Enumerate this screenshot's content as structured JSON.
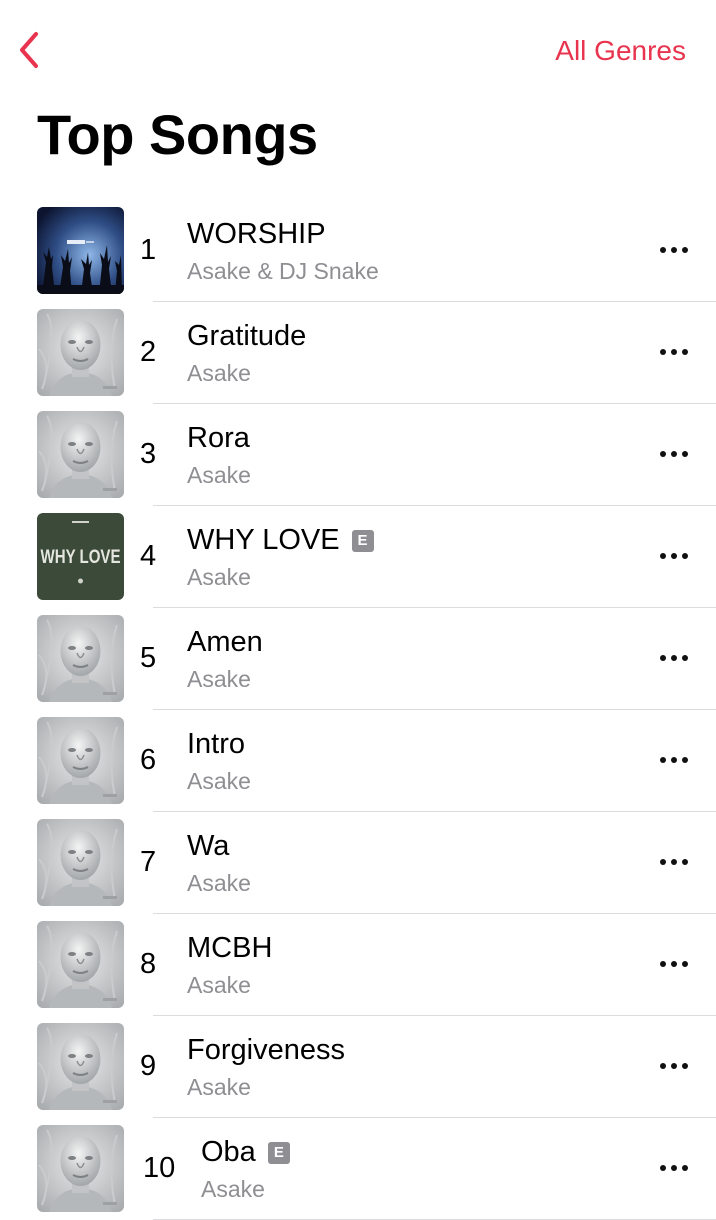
{
  "theme": {
    "accent": "#e8344e",
    "secondary_text": "#8e8e93"
  },
  "nav": {
    "back_icon": "chevron-left-icon",
    "genres_label": "All Genres"
  },
  "page": {
    "title": "Top Songs"
  },
  "songs": [
    {
      "rank": "1",
      "title": "WORSHIP",
      "artist": "Asake & DJ Snake",
      "explicit": false,
      "art": "worship-cover"
    },
    {
      "rank": "2",
      "title": "Gratitude",
      "artist": "Asake",
      "explicit": false,
      "art": "bust-cover"
    },
    {
      "rank": "3",
      "title": "Rora",
      "artist": "Asake",
      "explicit": false,
      "art": "bust-cover"
    },
    {
      "rank": "4",
      "title": "WHY LOVE",
      "artist": "Asake",
      "explicit": true,
      "explicit_label": "E",
      "art": "why-love-cover",
      "art_text": "WHY LOVE"
    },
    {
      "rank": "5",
      "title": "Amen",
      "artist": "Asake",
      "explicit": false,
      "art": "bust-cover"
    },
    {
      "rank": "6",
      "title": "Intro",
      "artist": "Asake",
      "explicit": false,
      "art": "bust-cover"
    },
    {
      "rank": "7",
      "title": "Wa",
      "artist": "Asake",
      "explicit": false,
      "art": "bust-cover"
    },
    {
      "rank": "8",
      "title": "MCBH",
      "artist": "Asake",
      "explicit": false,
      "art": "bust-cover"
    },
    {
      "rank": "9",
      "title": "Forgiveness",
      "artist": "Asake",
      "explicit": false,
      "art": "bust-cover"
    },
    {
      "rank": "10",
      "title": "Oba",
      "artist": "Asake",
      "explicit": true,
      "explicit_label": "E",
      "art": "bust-cover"
    }
  ]
}
